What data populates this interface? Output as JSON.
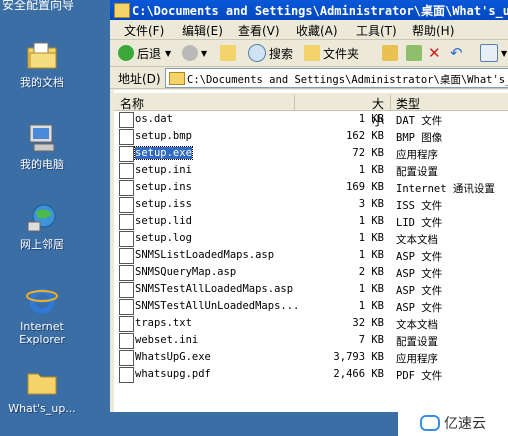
{
  "desktop": {
    "top_text": "安全配置向导",
    "icons": [
      {
        "label": "我的文档",
        "icon": "my-documents-icon"
      },
      {
        "label": "我的电脑",
        "icon": "my-computer-icon"
      },
      {
        "label": "网上邻居",
        "icon": "network-places-icon"
      },
      {
        "label": "Internet Explorer",
        "icon": "internet-explorer-icon"
      },
      {
        "label": "What's_up...",
        "icon": "folder-icon"
      }
    ]
  },
  "window": {
    "title": "C:\\Documents and Settings\\Administrator\\桌面\\What's_up",
    "menu": [
      "文件(F)",
      "编辑(E)",
      "查看(V)",
      "收藏(A)",
      "工具(T)",
      "帮助(H)"
    ],
    "toolbar": {
      "back": "后退",
      "search": "搜索",
      "folders": "文件夹"
    },
    "address_label": "地址(D)",
    "address_value": "C:\\Documents and Settings\\Administrator\\桌面\\What's_up"
  },
  "filelist": {
    "columns": [
      "名称",
      "大小",
      "类型"
    ],
    "rows": [
      {
        "name": "os.dat",
        "size": "1 KB",
        "type": "DAT 文件"
      },
      {
        "name": "setup.bmp",
        "size": "162 KB",
        "type": "BMP 图像"
      },
      {
        "name": "setup.exe",
        "size": "72 KB",
        "type": "应用程序"
      },
      {
        "name": "setup.ini",
        "size": "1 KB",
        "type": "配置设置"
      },
      {
        "name": "setup.ins",
        "size": "169 KB",
        "type": "Internet 通讯设置"
      },
      {
        "name": "setup.iss",
        "size": "3 KB",
        "type": "ISS 文件"
      },
      {
        "name": "setup.lid",
        "size": "1 KB",
        "type": "LID 文件"
      },
      {
        "name": "setup.log",
        "size": "1 KB",
        "type": "文本文档"
      },
      {
        "name": "SNMSListLoadedMaps.asp",
        "size": "1 KB",
        "type": "ASP 文件"
      },
      {
        "name": "SNMSQueryMap.asp",
        "size": "2 KB",
        "type": "ASP 文件"
      },
      {
        "name": "SNMSTestAllLoadedMaps.asp",
        "size": "1 KB",
        "type": "ASP 文件"
      },
      {
        "name": "SNMSTestAllUnLoadedMaps...",
        "size": "1 KB",
        "type": "ASP 文件"
      },
      {
        "name": "traps.txt",
        "size": "32 KB",
        "type": "文本文档"
      },
      {
        "name": "webset.ini",
        "size": "7 KB",
        "type": "配置设置"
      },
      {
        "name": "WhatsUpG.exe",
        "size": "3,793 KB",
        "type": "应用程序"
      },
      {
        "name": "whatsupg.pdf",
        "size": "2,466 KB",
        "type": "PDF 文件"
      }
    ],
    "selected_index": 2
  },
  "watermark": {
    "text": "亿速云"
  },
  "colors": {
    "desktop": "#3a6ea5",
    "titlebar": "#0a58d8",
    "selection": "#316ac5"
  }
}
